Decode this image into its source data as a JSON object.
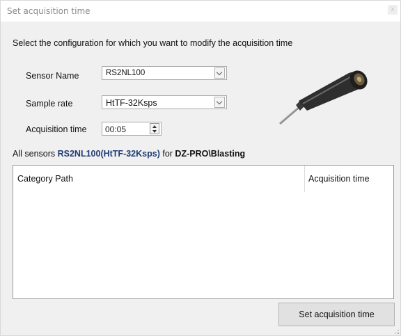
{
  "window": {
    "title": "Set acquisition time",
    "close_glyph": "x"
  },
  "instruction": "Select the configuration for which you want to modify the acquisition time",
  "form": {
    "sensor_name_label": "Sensor Name",
    "sensor_name_value": "RS2NL100",
    "sample_rate_label": "Sample rate",
    "sample_rate_value": "HtTF-32Ksps",
    "acquisition_time_label": "Acquisition time",
    "acquisition_time_value": "00:05"
  },
  "summary": {
    "prefix": "All sensors ",
    "sensor": "RS2NL100(HtTF-32Ksps)",
    "middle": " for ",
    "path": "DZ-PRO\\Blasting"
  },
  "table": {
    "columns": [
      "Category Path",
      "Acquisition time"
    ],
    "rows": []
  },
  "action_button_label": "Set acquisition time",
  "icons": {
    "sensor_image": "sensor-probe-image",
    "dropdown": "chevron-down-icon",
    "spinner": "spinner-arrows-icon",
    "close": "close-icon",
    "resize": "resize-grip-icon"
  }
}
